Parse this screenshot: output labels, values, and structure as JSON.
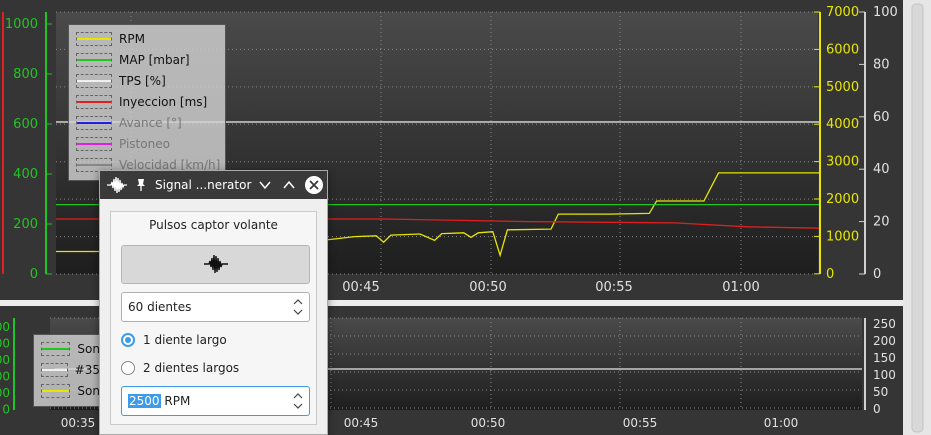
{
  "top_chart": {
    "left_axis_ticks": [
      "1000",
      "800",
      "600",
      "400",
      "200",
      "0"
    ],
    "rpm_axis_ticks": [
      "7000",
      "6000",
      "5000",
      "4000",
      "3000",
      "2000",
      "1000",
      "0"
    ],
    "pct_axis_ticks": [
      "100",
      "80",
      "60",
      "40",
      "20",
      "0"
    ],
    "time_ticks": [
      "00:45",
      "00:50",
      "00:55",
      "01:00"
    ],
    "legend": [
      {
        "label": "RPM",
        "color": "#e6e600",
        "dim": false
      },
      {
        "label": "MAP [mbar]",
        "color": "#22c422",
        "dim": false
      },
      {
        "label": "TPS [%]",
        "color": "#f0f0f0",
        "dim": false
      },
      {
        "label": "Inyeccion [ms]",
        "color": "#e02020",
        "dim": false
      },
      {
        "label": "Avance [°]",
        "color": "#2020e0",
        "dim": true
      },
      {
        "label": "Pistoneo",
        "color": "#e020e0",
        "dim": true
      },
      {
        "label": "Velocidad [km/h]",
        "color": "#888888",
        "dim": true
      }
    ]
  },
  "bottom_chart": {
    "left_axis_ticks": [
      "00",
      "00",
      "00",
      "00",
      "00",
      "0"
    ],
    "right_axis_ticks": [
      "250",
      "200",
      "150",
      "100",
      "50",
      "0"
    ],
    "time_ticks": [
      "00:35",
      "00:45",
      "00:50",
      "00:55",
      "01:00"
    ],
    "legend": [
      {
        "label": "Son",
        "color": "#22c422"
      },
      {
        "label": "#35",
        "color": "#f0f0f0"
      },
      {
        "label": "Son",
        "color": "#e6e600"
      }
    ]
  },
  "chart_data": {
    "type": "line",
    "x_domain": [
      "00:40",
      "01:03"
    ],
    "y_left_lim": [
      0,
      1000
    ],
    "y_rpm_lim": [
      0,
      7000
    ],
    "y_pct_lim": [
      0,
      100
    ],
    "grid": true,
    "legend_position": "top-left",
    "series": [
      {
        "name": "RPM",
        "axis": "rpm",
        "color": "#e6e600",
        "points": [
          [
            0,
            600
          ],
          [
            2.2,
            600
          ],
          [
            3.5,
            680
          ],
          [
            4.4,
            700
          ],
          [
            5.7,
            780
          ],
          [
            6.0,
            900
          ],
          [
            6.2,
            500
          ],
          [
            6.4,
            900
          ],
          [
            7.0,
            930
          ],
          [
            7.5,
            920
          ],
          [
            8.2,
            1000
          ],
          [
            8.8,
            1020
          ],
          [
            9.0,
            850
          ],
          [
            9.2,
            1040
          ],
          [
            10.0,
            1070
          ],
          [
            10.4,
            900
          ],
          [
            10.6,
            1080
          ],
          [
            11.2,
            1100
          ],
          [
            11.4,
            980
          ],
          [
            11.6,
            1100
          ],
          [
            12.0,
            1130
          ],
          [
            12.2,
            500
          ],
          [
            12.4,
            1180
          ],
          [
            13.6,
            1200
          ],
          [
            13.8,
            1600
          ],
          [
            15.0,
            1600
          ],
          [
            15.2,
            1600
          ],
          [
            16.3,
            1620
          ],
          [
            16.5,
            1950
          ],
          [
            17.8,
            1950
          ],
          [
            18.2,
            2700
          ],
          [
            20.2,
            2700
          ],
          [
            21.0,
            2700
          ]
        ]
      },
      {
        "name": "MAP [mbar]",
        "axis": "left",
        "color": "#22c422",
        "points": [
          [
            0,
            265
          ],
          [
            21.0,
            265
          ]
        ]
      },
      {
        "name": "TPS [%]",
        "axis": "pct",
        "color": "#f0f0f0",
        "points": [
          [
            0,
            58
          ],
          [
            21.0,
            58
          ]
        ]
      },
      {
        "name": "Inyeccion [ms]",
        "axis": "left",
        "color": "#e02020",
        "points": [
          [
            0,
            210
          ],
          [
            9.0,
            210
          ],
          [
            13.0,
            200
          ],
          [
            17.0,
            195
          ],
          [
            19.0,
            180
          ],
          [
            21.0,
            175
          ]
        ]
      }
    ]
  },
  "dialog": {
    "title": "Signal ...nerator",
    "panel_title": "Pulsos captor volante",
    "teeth_value": "60 dientes",
    "radio1_label": "1 diente largo",
    "radio2_label": "2 dientes largos",
    "rpm_value": "2500",
    "rpm_unit": "RPM"
  }
}
